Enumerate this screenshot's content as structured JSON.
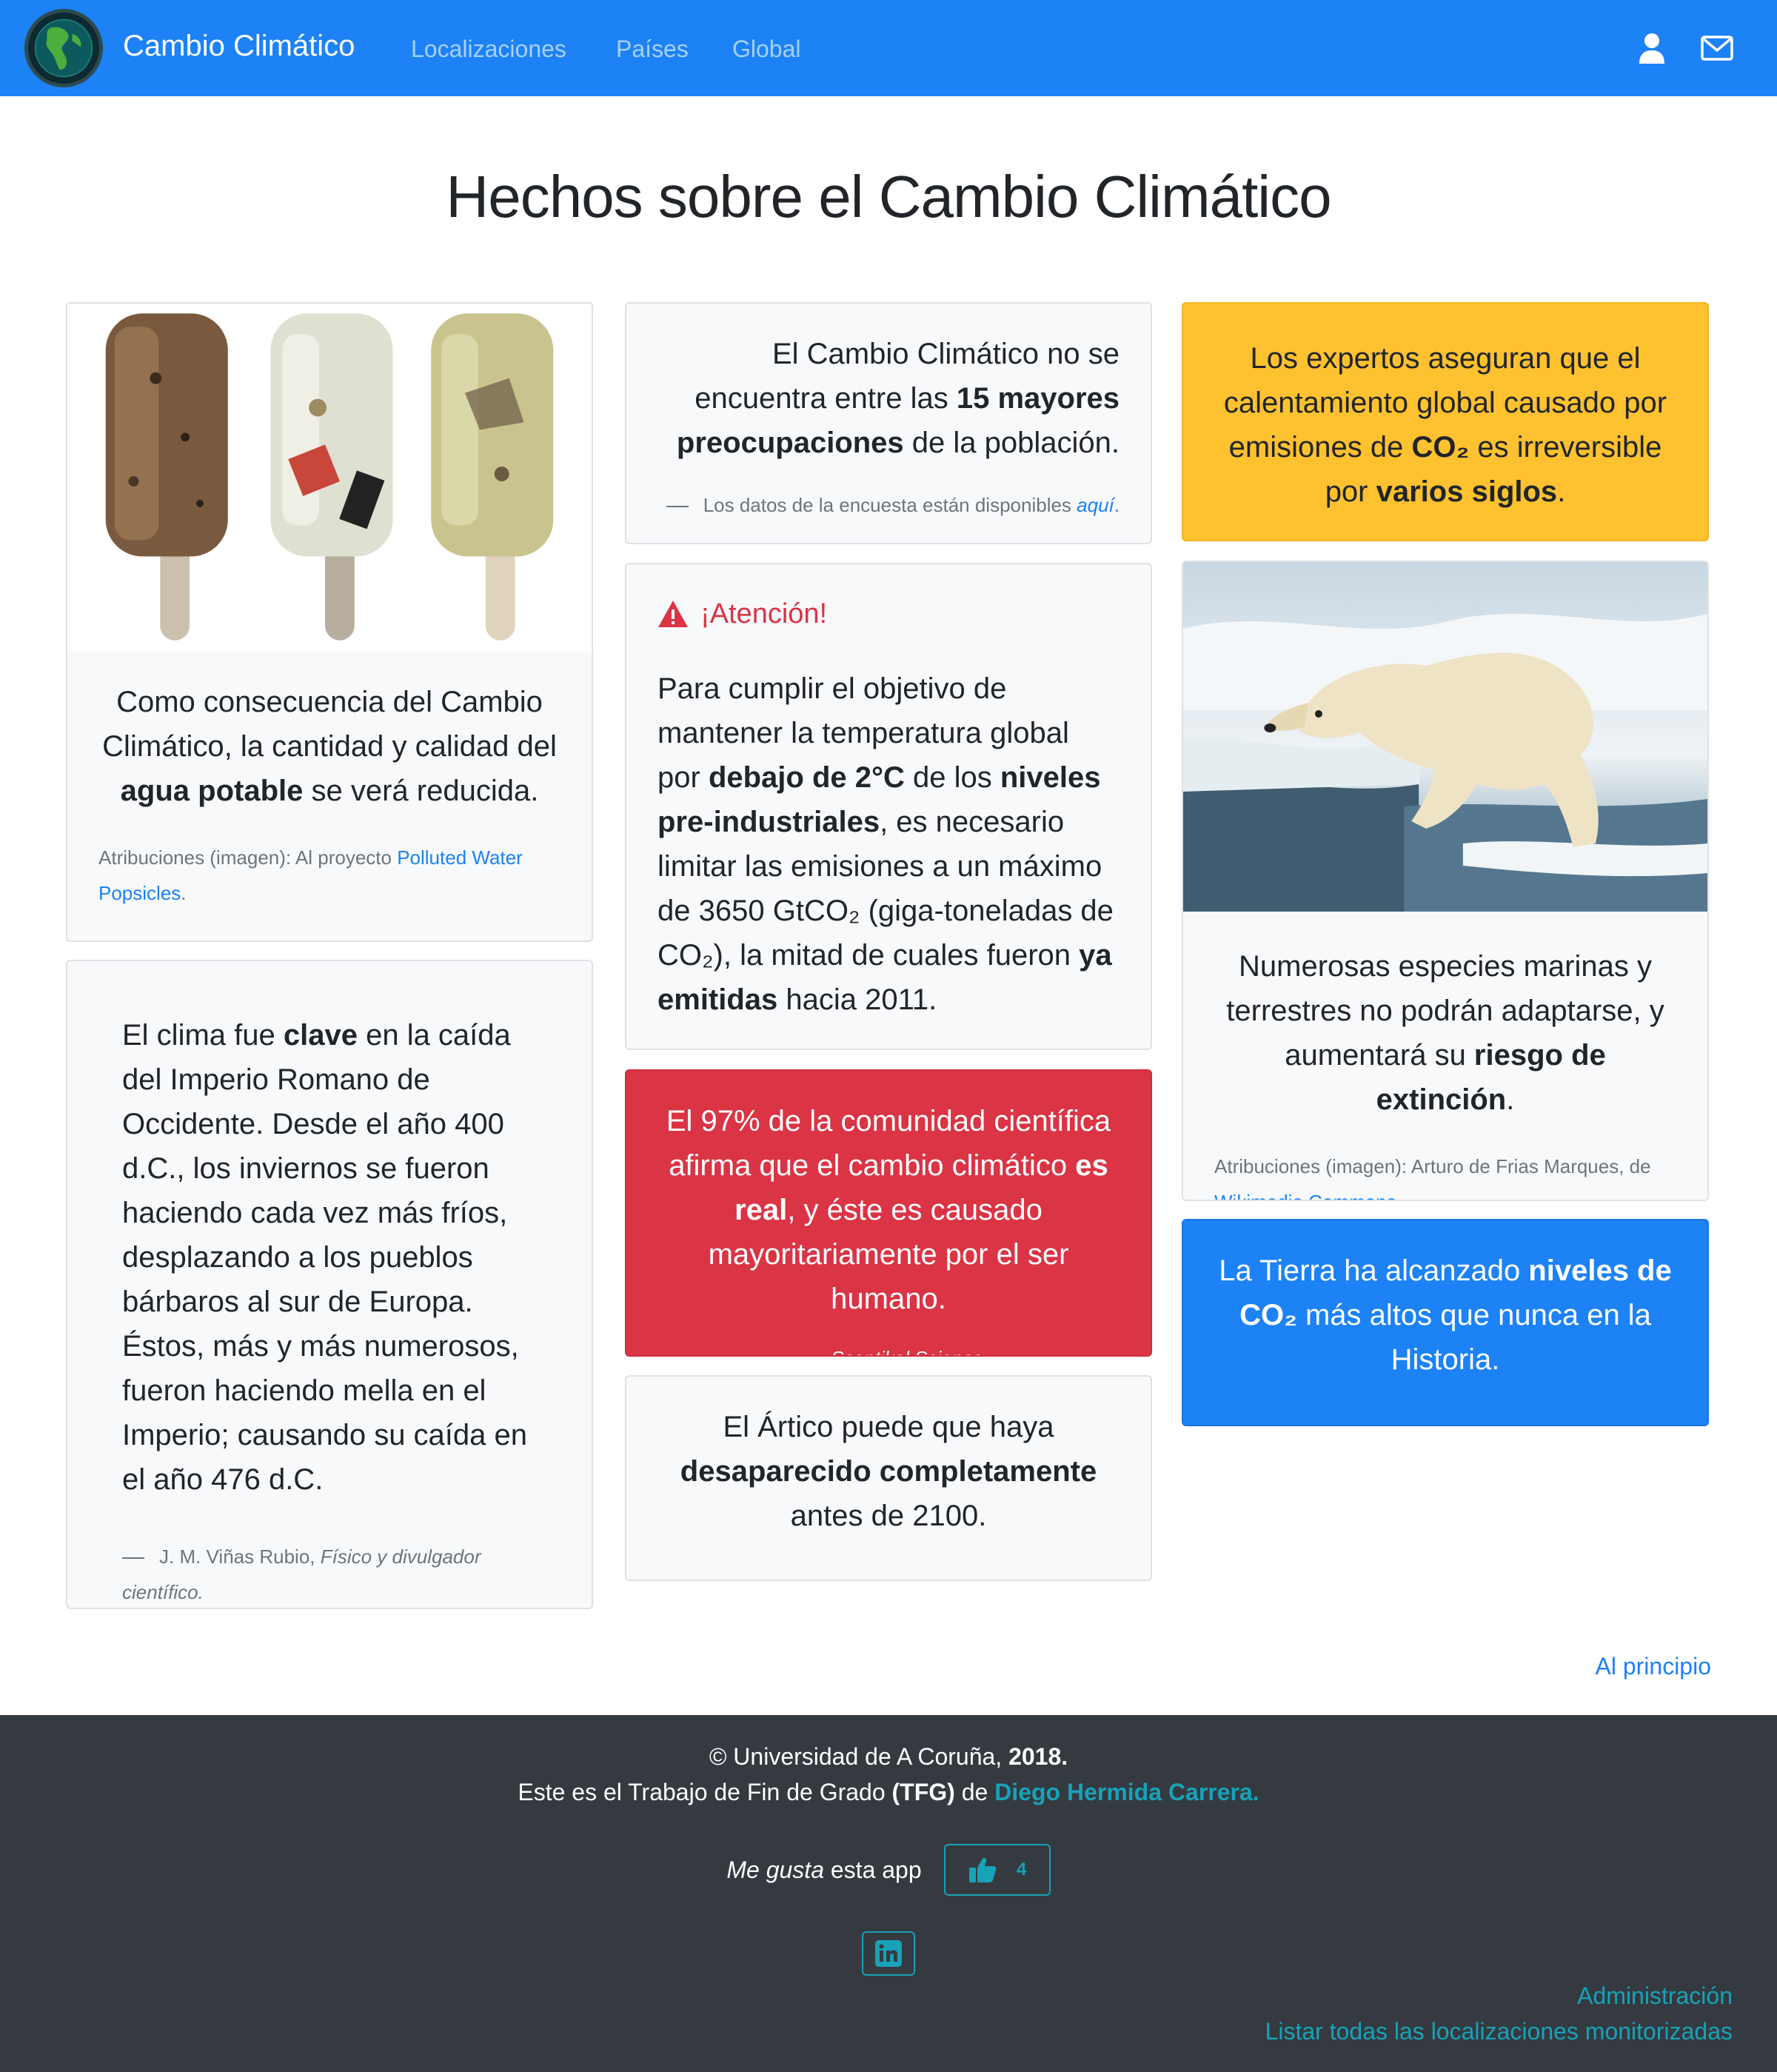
{
  "navbar": {
    "brand": "Cambio Climático",
    "links": [
      "Localizaciones",
      "Países",
      "Global"
    ]
  },
  "page_title": "Hechos sobre el Cambio Climático",
  "cards": {
    "water": {
      "text_pre": "Como consecuencia del Cambio Climático, la cantidad y calidad del ",
      "text_bold": "agua potable",
      "text_post": " se verá reducida.",
      "attrib_prefix": "Atribuciones (imagen): Al proyecto ",
      "attrib_link": "Polluted Water Popsicles",
      "attrib_suffix": "."
    },
    "rome": {
      "text_pre": "El clima fue ",
      "text_bold": "clave",
      "text_post": " en la caída del Imperio Romano de Occidente. Desde el año 400 d.C., los inviernos se fueron haciendo cada vez más fríos, desplazando a los pueblos bárbaros al sur de Europa. Éstos, más y más numerosos, fueron haciendo mella en el Imperio; causando su caída en el año 476 d.C.",
      "author": "J. M. Viñas Rubio, ",
      "author_role": "Físico y divulgador científico."
    },
    "survey": {
      "text_pre": "El Cambio Climático no se encuentra entre las ",
      "text_bold": "15 mayores preocupaciones",
      "text_post": " de la población.",
      "foot_prefix": "Los datos de la encuesta están disponibles ",
      "foot_link": "aquí",
      "foot_suffix": "."
    },
    "attention": {
      "title": "¡Atención!",
      "p1": "Para cumplir el objetivo de mantener la temperatura global por ",
      "b1": "debajo de 2°C",
      "p2": " de los ",
      "b2": "niveles pre-industriales",
      "p3": ", es necesario limitar las emisiones a un máximo de 3650 GtCO₂ (giga-toneladas de CO₂), la mitad de cuales fueron ",
      "b3": "ya emitidas",
      "p4": " hacia 2011."
    },
    "consensus": {
      "text_pre": "El 97% de la comunidad científica afirma que el cambio climático ",
      "text_bold": "es real",
      "text_post": ", y éste es causado mayoritariamente por el ser humano.",
      "source": "Sceptikal Science"
    },
    "arctic": {
      "text_pre": "El Ártico puede que haya ",
      "text_bold": "desaparecido completamente",
      "text_post": " antes de 2100."
    },
    "experts": {
      "text_pre": "Los expertos aseguran que el calentamiento global causado por emisiones de ",
      "b1": "CO₂",
      "text_mid": " es irreversible por ",
      "b2": "varios siglos",
      "text_post": "."
    },
    "species": {
      "text_pre": "Numerosas especies marinas y terrestres no podrán adaptarse, y aumentará su ",
      "text_bold": "riesgo de extinción",
      "text_post": ".",
      "attrib_prefix": "Atribuciones (imagen): Arturo de Frias Marques, de ",
      "attrib_link": "Wikimedia Commons",
      "attrib_suffix": "."
    },
    "co2": {
      "text_pre": "La Tierra ha alcanzado ",
      "text_bold": "niveles de CO₂",
      "text_post": " más altos que nunca en la Historia."
    }
  },
  "to_top": "Al principio",
  "footer": {
    "copyright_pre": "© Universidad de A Coruña, ",
    "copyright_year": "2018.",
    "tfg_pre": "Este es el Trabajo de Fin de Grado ",
    "tfg_abbr": "(TFG)",
    "tfg_mid": " de ",
    "tfg_author": "Diego Hermida Carrera.",
    "like_em": "Me gusta",
    "like_rest": " esta app",
    "like_count": "4",
    "admin": "Administración",
    "list_all": "Listar todas las localizaciones monitorizadas"
  },
  "colors": {
    "primary": "#1c82f5",
    "warning": "#fec12f",
    "danger": "#da3445",
    "footer": "#343a40",
    "info": "#17a2b8"
  },
  "icons": [
    "globe-logo-icon",
    "user-icon",
    "envelope-icon",
    "warning-triangle-icon",
    "thumbs-up-icon",
    "linkedin-icon"
  ]
}
